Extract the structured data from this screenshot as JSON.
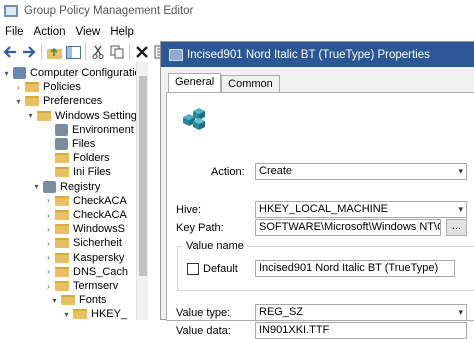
{
  "window": {
    "title": "Group Policy Management Editor"
  },
  "menu": [
    "File",
    "Action",
    "View",
    "Help"
  ],
  "toolbar": {
    "icons": [
      "back-icon",
      "forward-icon",
      "up-folder-icon",
      "show-hide-tree-icon",
      "cut-icon",
      "copy-icon",
      "delete-icon",
      "properties-icon"
    ]
  },
  "tree": {
    "items": [
      {
        "label": "Computer Configuration",
        "icon": "computer-icon",
        "expander": "▾"
      },
      {
        "label": "Policies",
        "icon": "folder-icon",
        "expander": "›"
      },
      {
        "label": "Preferences",
        "icon": "folder-icon",
        "expander": "▾"
      },
      {
        "label": "Windows Settings",
        "icon": "folder-icon",
        "expander": "▾"
      },
      {
        "label": "Environment",
        "icon": "environment-icon",
        "expander": ""
      },
      {
        "label": "Files",
        "icon": "files-icon",
        "expander": ""
      },
      {
        "label": "Folders",
        "icon": "folders-icon",
        "expander": ""
      },
      {
        "label": "Ini Files",
        "icon": "ini-files-icon",
        "expander": ""
      },
      {
        "label": "Registry",
        "icon": "registry-icon",
        "expander": "▾"
      },
      {
        "label": "CheckACA",
        "icon": "folder-icon",
        "expander": "›"
      },
      {
        "label": "CheckACA",
        "icon": "folder-icon",
        "expander": "›"
      },
      {
        "label": "WindowsS",
        "icon": "folder-icon",
        "expander": "›"
      },
      {
        "label": "Sicherheit",
        "icon": "folder-icon",
        "expander": "›"
      },
      {
        "label": "Kaspersky",
        "icon": "folder-icon",
        "expander": "›"
      },
      {
        "label": "DNS_Cach",
        "icon": "folder-icon",
        "expander": "›"
      },
      {
        "label": "Termserv",
        "icon": "folder-icon",
        "expander": "›"
      },
      {
        "label": "Fonts",
        "icon": "folder-icon",
        "expander": "▾"
      },
      {
        "label": "HKEY_",
        "icon": "folder-icon",
        "expander": "▾"
      }
    ]
  },
  "dialog": {
    "title": "Incised901 Nord Italic BT (TrueType) Properties",
    "tabs": [
      "General",
      "Common"
    ],
    "action_label": "Action:",
    "action_value": "Create",
    "hive_label": "Hive:",
    "hive_value": "HKEY_LOCAL_MACHINE",
    "key_path_label": "Key Path:",
    "key_path_value": "SOFTWARE\\Microsoft\\Windows NT\\CurrentVer",
    "browse_label": "...",
    "value_name_group": "Value name",
    "default_label": "Default",
    "value_name_value": "Incised901 Nord Italic BT (TrueType)",
    "value_type_label": "Value type:",
    "value_type_value": "REG_SZ",
    "value_data_label": "Value data:",
    "value_data_value": "IN901XKI.TTF"
  },
  "colors": {
    "titlebar": "#2b5797",
    "folder": "#e8c064"
  }
}
